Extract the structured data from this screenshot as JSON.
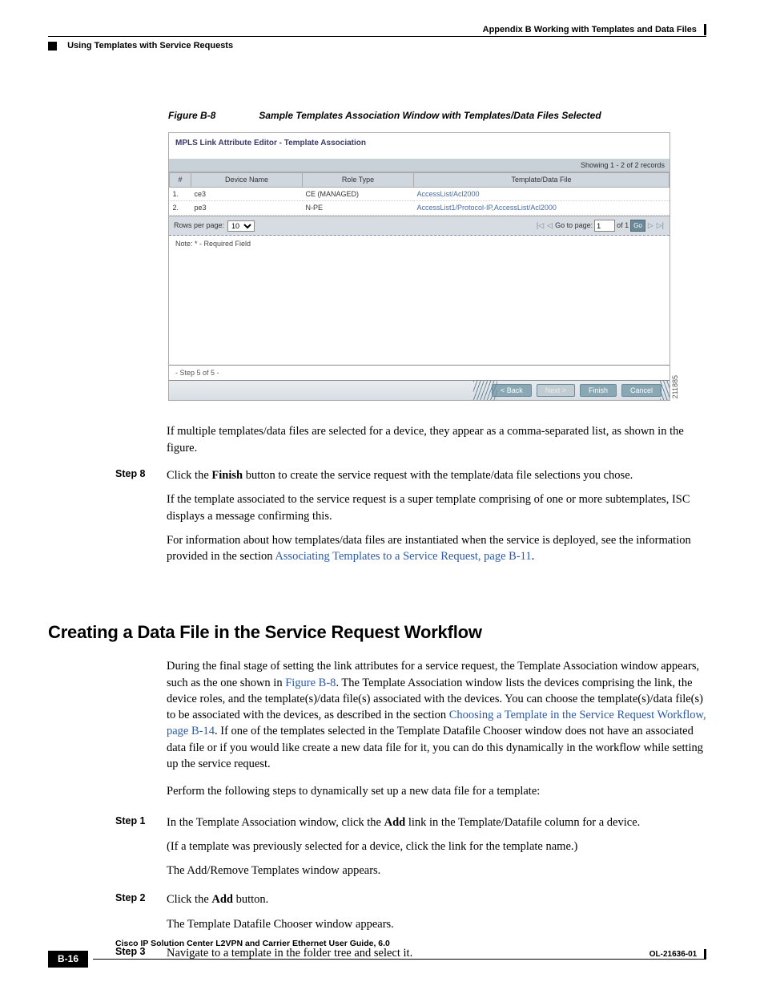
{
  "header": {
    "right": "Appendix B      Working with Templates and Data Files",
    "left": "Using Templates with Service Requests"
  },
  "figure": {
    "num": "Figure B-8",
    "title": "Sample Templates Association Window with Templates/Data Files Selected"
  },
  "screenshot": {
    "title": "MPLS Link Attribute Editor - Template Association",
    "showing": "Showing 1 - 2 of 2 records",
    "columns": {
      "num": "#",
      "device": "Device Name",
      "role": "Role Type",
      "template": "Template/Data File"
    },
    "rows": [
      {
        "n": "1.",
        "device": "ce3",
        "role": "CE (MANAGED)",
        "template": "AccessList/Acl2000"
      },
      {
        "n": "2.",
        "device": "pe3",
        "role": "N-PE",
        "template": "AccessList1/Protocol-IP,AccessList/Acl2000"
      }
    ],
    "pager": {
      "rowsPerPage": "Rows per page:",
      "rowsVal": "10",
      "gotoPage": "Go to page:",
      "gotoVal": "1",
      "of": "of 1",
      "go": "Go"
    },
    "note": "Note: * - Required Field",
    "step": "- Step 5 of 5 -",
    "buttons": {
      "back": "< Back",
      "next": "Next >",
      "finish": "Finish",
      "cancel": "Cancel"
    },
    "sideId": "211885"
  },
  "para_after_figure": "If multiple templates/data files are selected for a device, they appear as a comma-separated list, as shown in the figure.",
  "step8": {
    "label": "Step 8",
    "line1a": "Click the ",
    "line1b": "Finish",
    "line1c": " button to create the service request with the template/data file selections you chose.",
    "p2": "If the template associated to the service request is a super template comprising of one or more subtemplates, ISC displays a message confirming this.",
    "p3a": "For information about how templates/data files are instantiated when the service is deployed, see the information provided in the section ",
    "p3link": "Associating Templates to a Service Request, page B-11",
    "p3b": "."
  },
  "section_title": "Creating a Data File in the Service Request Workflow",
  "intro": {
    "p1a": "During the final stage of setting the link attributes for a service request, the Template Association window appears, such as the one shown in ",
    "p1link1": "Figure B-8",
    "p1b": ". The Template Association window lists the devices comprising the link, the device roles, and the template(s)/data file(s) associated with the devices. You can choose the template(s)/data file(s) to be associated with the devices, as described in the section ",
    "p1link2": "Choosing a Template in the Service Request Workflow, page B-14",
    "p1c": ". If one of the templates selected in the Template Datafile Chooser window does not have an associated data file or if you would like create a new data file for it, you can do this dynamically in the workflow while setting up the service request.",
    "p2": "Perform the following steps to dynamically set up a new data file for a template:"
  },
  "steps": {
    "s1": {
      "label": "Step 1",
      "l1a": "In the Template Association window, click the ",
      "l1b": "Add",
      "l1c": " link in the Template/Datafile column for a device.",
      "l2": "(If a template was previously selected for a device, click the link for the template name.)",
      "l3": "The Add/Remove Templates window appears."
    },
    "s2": {
      "label": "Step 2",
      "l1a": "Click the ",
      "l1b": "Add",
      "l1c": " button.",
      "l2": "The Template Datafile Chooser window appears."
    },
    "s3": {
      "label": "Step 3",
      "l1": "Navigate to a template in the folder tree and select it."
    }
  },
  "footer": {
    "title": "Cisco IP Solution Center L2VPN and Carrier Ethernet User Guide, 6.0",
    "page": "B-16",
    "doc": "OL-21636-01"
  }
}
